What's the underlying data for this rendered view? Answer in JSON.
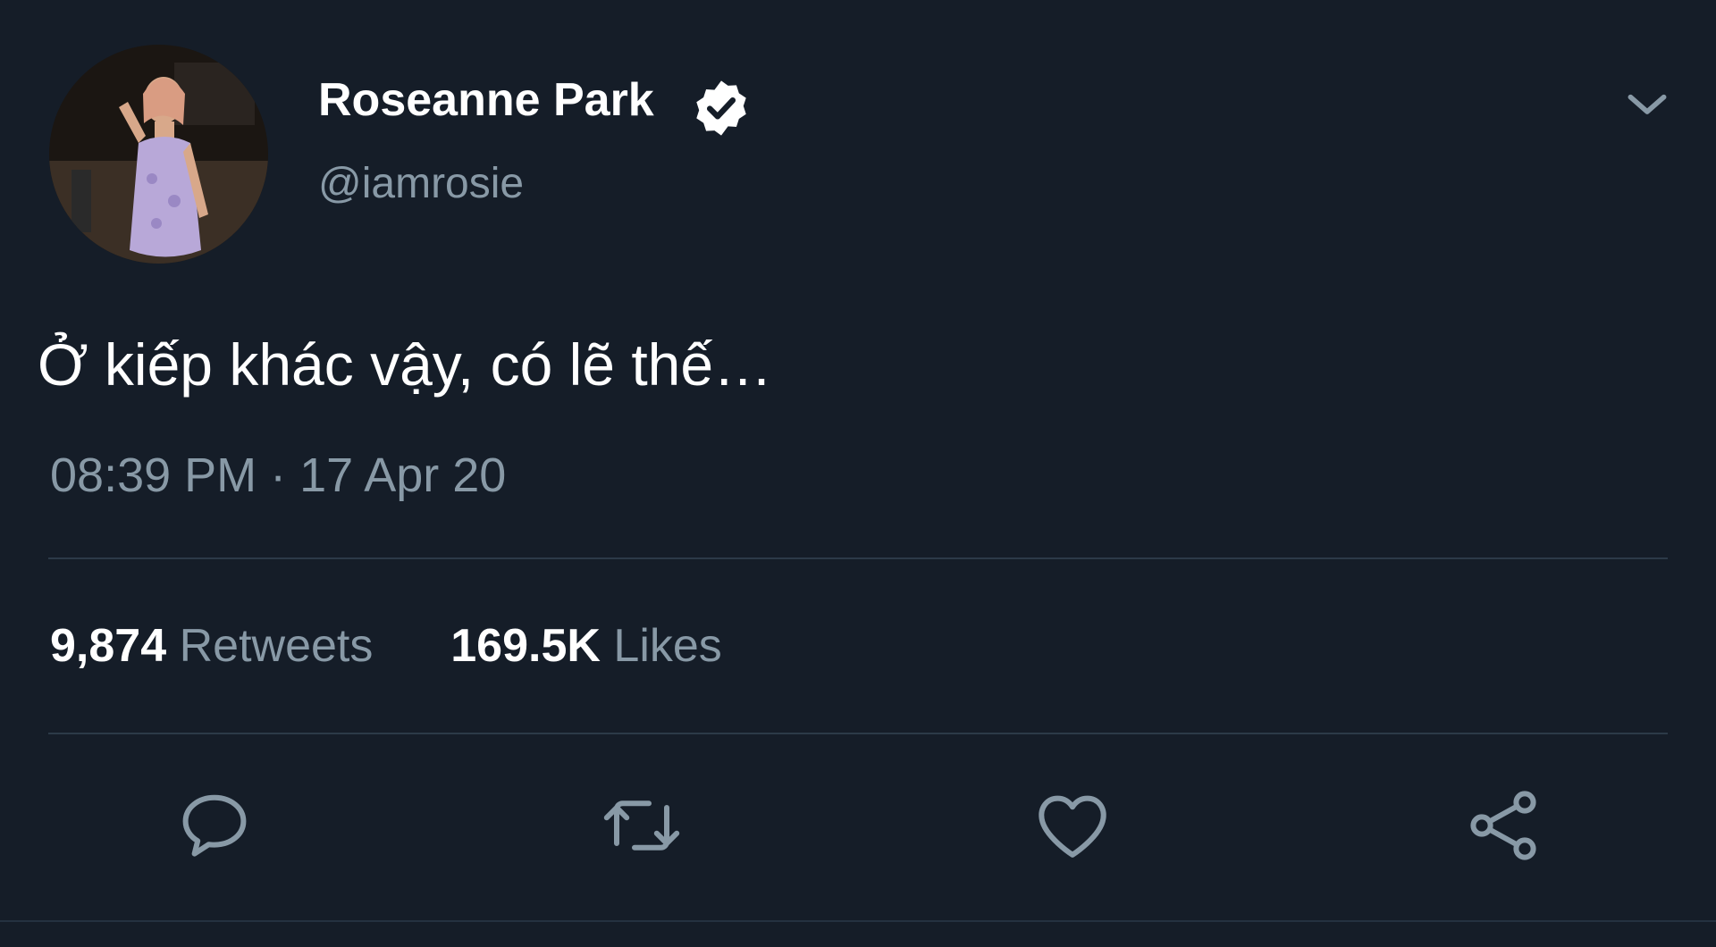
{
  "tweet": {
    "user": {
      "display_name": "Roseanne Park",
      "handle": "@iamrosie",
      "verified": true,
      "avatar_icon": "profile-photo"
    },
    "text": "Ở kiếp khác vậy, có lẽ thế…",
    "timestamp": "08:39 PM · 17 Apr 20",
    "stats": {
      "retweets_count": "9,874",
      "retweets_label": "Retweets",
      "likes_count": "169.5K",
      "likes_label": "Likes"
    },
    "actions": [
      {
        "name": "reply",
        "icon": "speech-bubble-icon"
      },
      {
        "name": "retweet",
        "icon": "retweet-arrows-icon"
      },
      {
        "name": "like",
        "icon": "heart-icon"
      },
      {
        "name": "share",
        "icon": "share-nodes-icon"
      }
    ]
  },
  "colors": {
    "background": "#151d28",
    "primary_text": "#ffffff",
    "secondary_text": "#8899a6",
    "divider": "#2c3a48",
    "icon": "#8899a6"
  }
}
